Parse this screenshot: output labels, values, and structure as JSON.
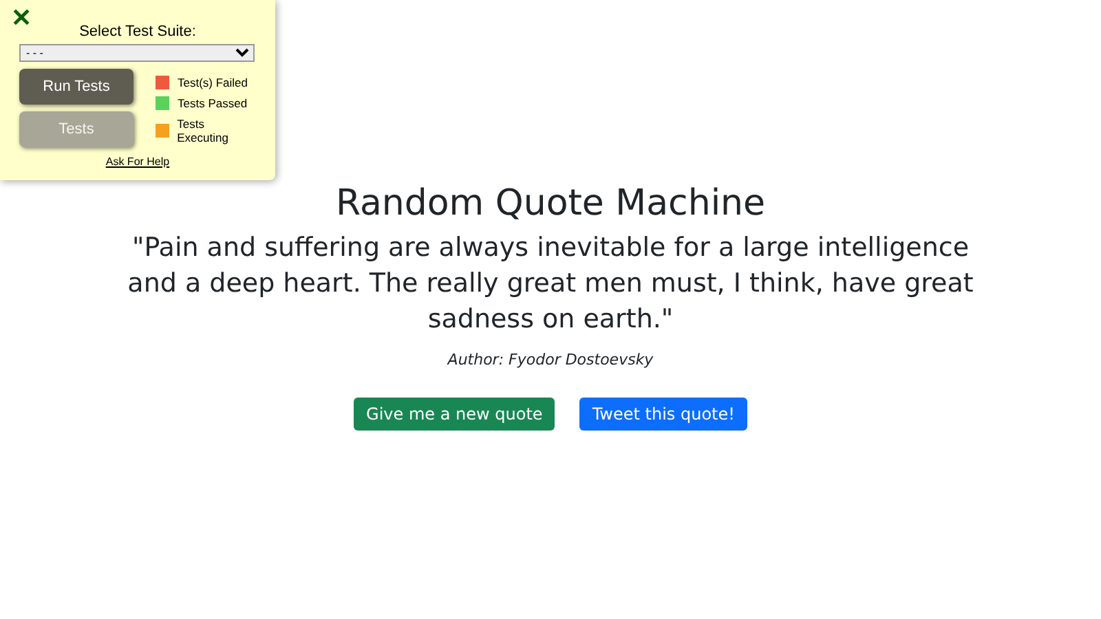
{
  "test_panel": {
    "close": "✕",
    "title": "Select Test Suite:",
    "suite_select": {
      "value": "- - -"
    },
    "buttons": [
      {
        "label": "Run Tests",
        "kind": "primary"
      },
      {
        "label": "Tests",
        "kind": "secondary"
      }
    ],
    "legend": [
      {
        "label": "Test(s) Failed",
        "color": "#f05a3c"
      },
      {
        "label": "Tests Passed",
        "color": "#5ad25a"
      },
      {
        "label": "Tests Executing",
        "color": "#f5a01e"
      }
    ],
    "help_link": "Ask For Help"
  },
  "title": "Random Quote Machine",
  "quote": "\"Pain and suffering are always inevitable for a large intelligence and a deep heart. The really great men must, I think, have great sadness on earth.\"",
  "author": "Author: Fyodor Dostoevsky",
  "actions": [
    {
      "label": "Give me a new quote",
      "kind": "new"
    },
    {
      "label": "Tweet this quote!",
      "kind": "tweet"
    }
  ]
}
